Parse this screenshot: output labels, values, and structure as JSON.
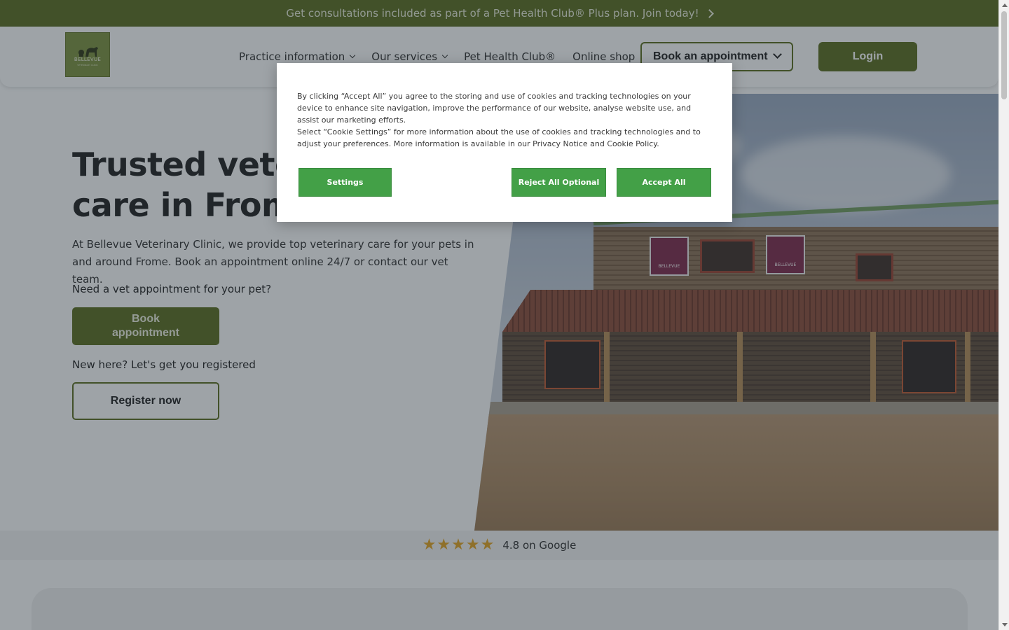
{
  "promo": {
    "text": "Get consultations included as part of a Pet Health Club® Plus plan. Join today!"
  },
  "header": {
    "logo": {
      "name": "BELLEVUE",
      "sub": "VETERINARY CLINIC"
    },
    "nav": [
      {
        "label": "Practice information",
        "dropdown": true
      },
      {
        "label": "Our services",
        "dropdown": true
      },
      {
        "label": "Pet Health Club®",
        "dropdown": false
      },
      {
        "label": "Online shop",
        "dropdown": false
      }
    ],
    "book_dropdown_label": "Book an appointment",
    "login_label": "Login"
  },
  "hero": {
    "title_line1": "Trusted veterinary",
    "title_line2": "care in Frome",
    "description": "At Bellevue Veterinary Clinic, we provide top veterinary care for your pets in and around Frome. Book an appointment online 24/7 or contact our vet team.",
    "need_text": "Need a vet appointment for your pet?",
    "book_label": "Book appointment",
    "new_text": "New here? Let's get you registered",
    "register_label": "Register now",
    "photo_signs": [
      "BELLEVUE",
      "BELLEVUE"
    ]
  },
  "rating": {
    "stars": 4.8,
    "text": "4.8 on Google"
  },
  "cookie_modal": {
    "paragraph1": "By clicking “Accept All” you agree to the storing and use of cookies and tracking technologies on your device to enhance site navigation, improve the performance of our website, analyse website use, and assist our marketing efforts.",
    "paragraph2": "Select “Cookie Settings” for more information about the use of cookies and tracking technologies and to adjust your preferences. More information is available in our Privacy Notice and Cookie Policy.",
    "settings_label": "Settings",
    "reject_label": "Reject All Optional",
    "accept_label": "Accept All"
  },
  "colors": {
    "brand_green": "#586a1b",
    "cookie_green": "#43a047",
    "star": "#e3a31c"
  }
}
